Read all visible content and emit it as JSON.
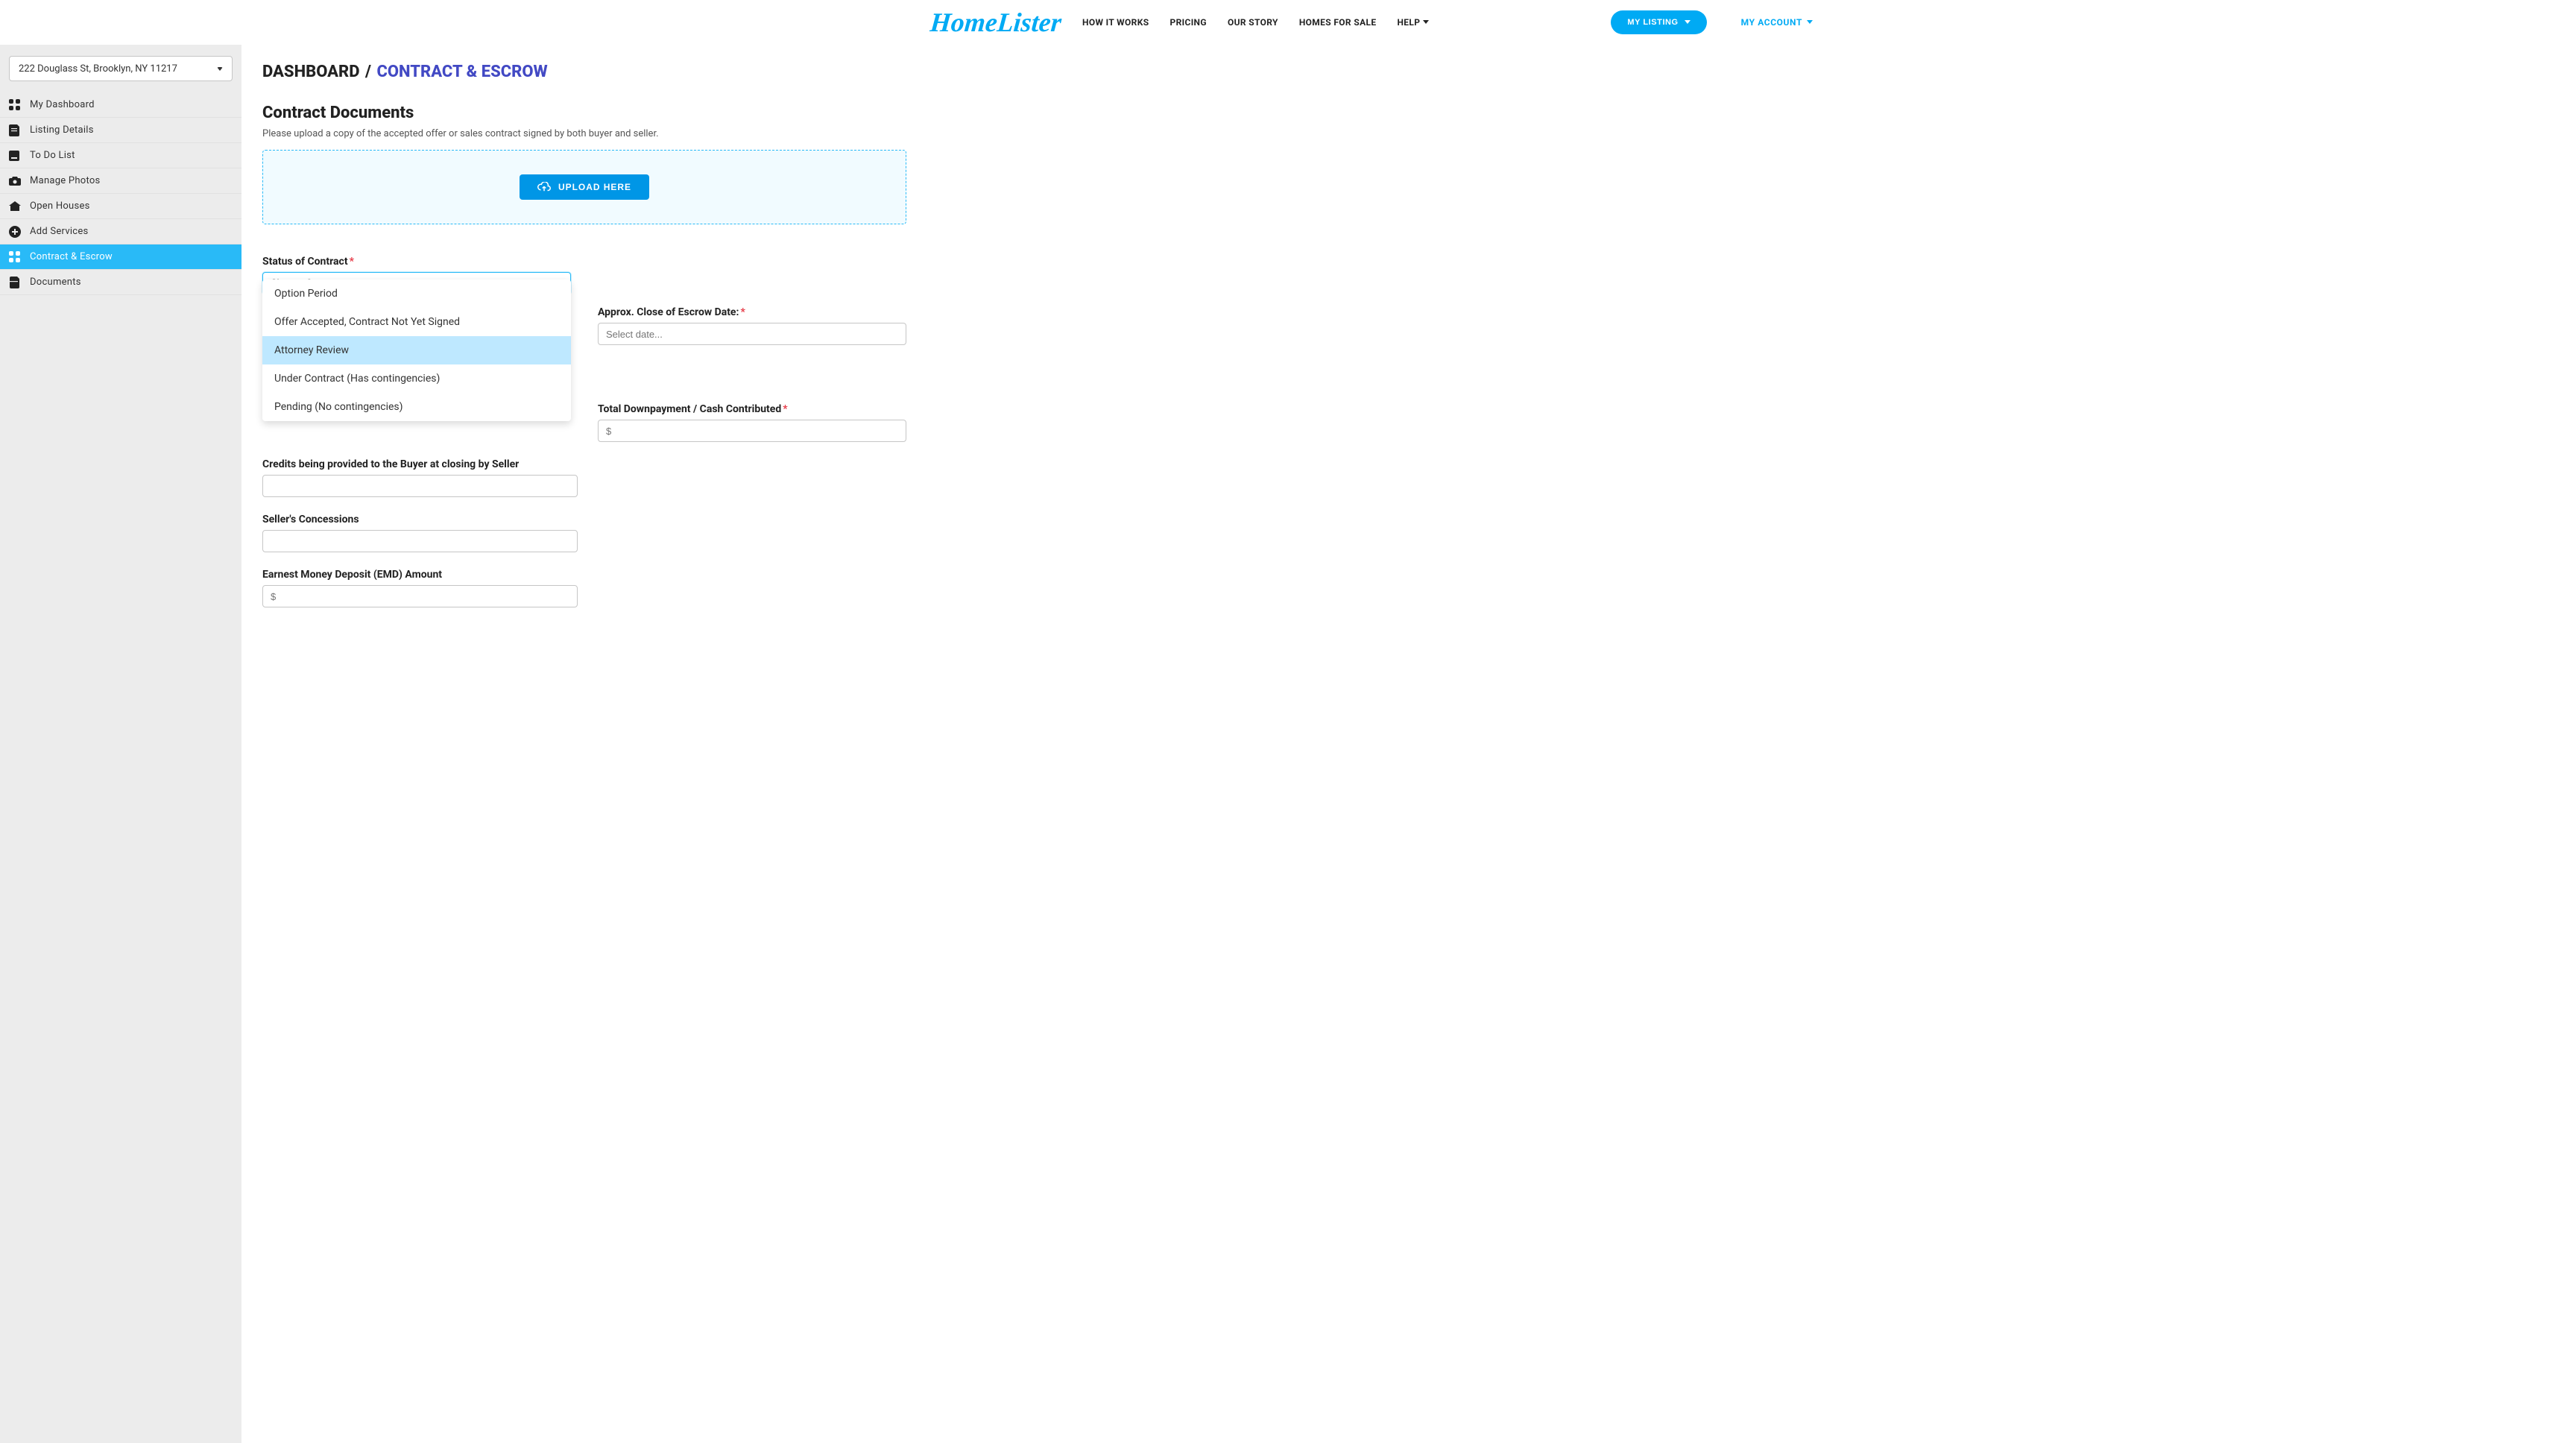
{
  "header": {
    "logo_text": "HomeLister",
    "nav": {
      "how_it_works": "HOW IT WORKS",
      "pricing": "PRICING",
      "our_story": "OUR STORY",
      "homes_for_sale": "HOMES FOR SALE",
      "help": "HELP"
    },
    "my_listing": "MY LISTING",
    "my_account": "MY ACCOUNT"
  },
  "sidebar": {
    "address": "222 Douglass St, Brooklyn, NY 11217",
    "items": [
      {
        "label": "My Dashboard",
        "key": "dashboard"
      },
      {
        "label": "Listing Details",
        "key": "listing-details"
      },
      {
        "label": "To Do List",
        "key": "todo"
      },
      {
        "label": "Manage Photos",
        "key": "photos"
      },
      {
        "label": "Open Houses",
        "key": "open-houses"
      },
      {
        "label": "Add Services",
        "key": "add-services"
      },
      {
        "label": "Contract & Escrow",
        "key": "contract-escrow"
      },
      {
        "label": "Documents",
        "key": "documents"
      }
    ],
    "active_index": 6
  },
  "breadcrumb": {
    "part1": "DASHBOARD",
    "sep": "/",
    "part2": "CONTRACT & ESCROW"
  },
  "main": {
    "contract_docs_title": "Contract Documents",
    "contract_docs_desc": "Please upload a copy of the accepted offer or sales contract signed by both buyer and seller.",
    "upload_button": "UPLOAD HERE",
    "status": {
      "label": "Status of Contract",
      "placeholder": "Choose One...",
      "options": [
        "Option Period",
        "Offer Accepted, Contract Not Yet Signed",
        "Attorney Review",
        "Under Contract (Has contingencies)",
        "Pending (No contingencies)"
      ],
      "highlighted_index": 2
    },
    "close_date": {
      "label": "Approx. Close of Escrow Date:",
      "placeholder": "Select date..."
    },
    "downpayment": {
      "label": "Total Downpayment / Cash Contributed",
      "placeholder": "$"
    },
    "credits": {
      "label": "Credits being provided to the Buyer at closing by Seller"
    },
    "concessions": {
      "label": "Seller's Concessions"
    },
    "emd": {
      "label": "Earnest Money Deposit (EMD) Amount",
      "placeholder": "$"
    }
  }
}
